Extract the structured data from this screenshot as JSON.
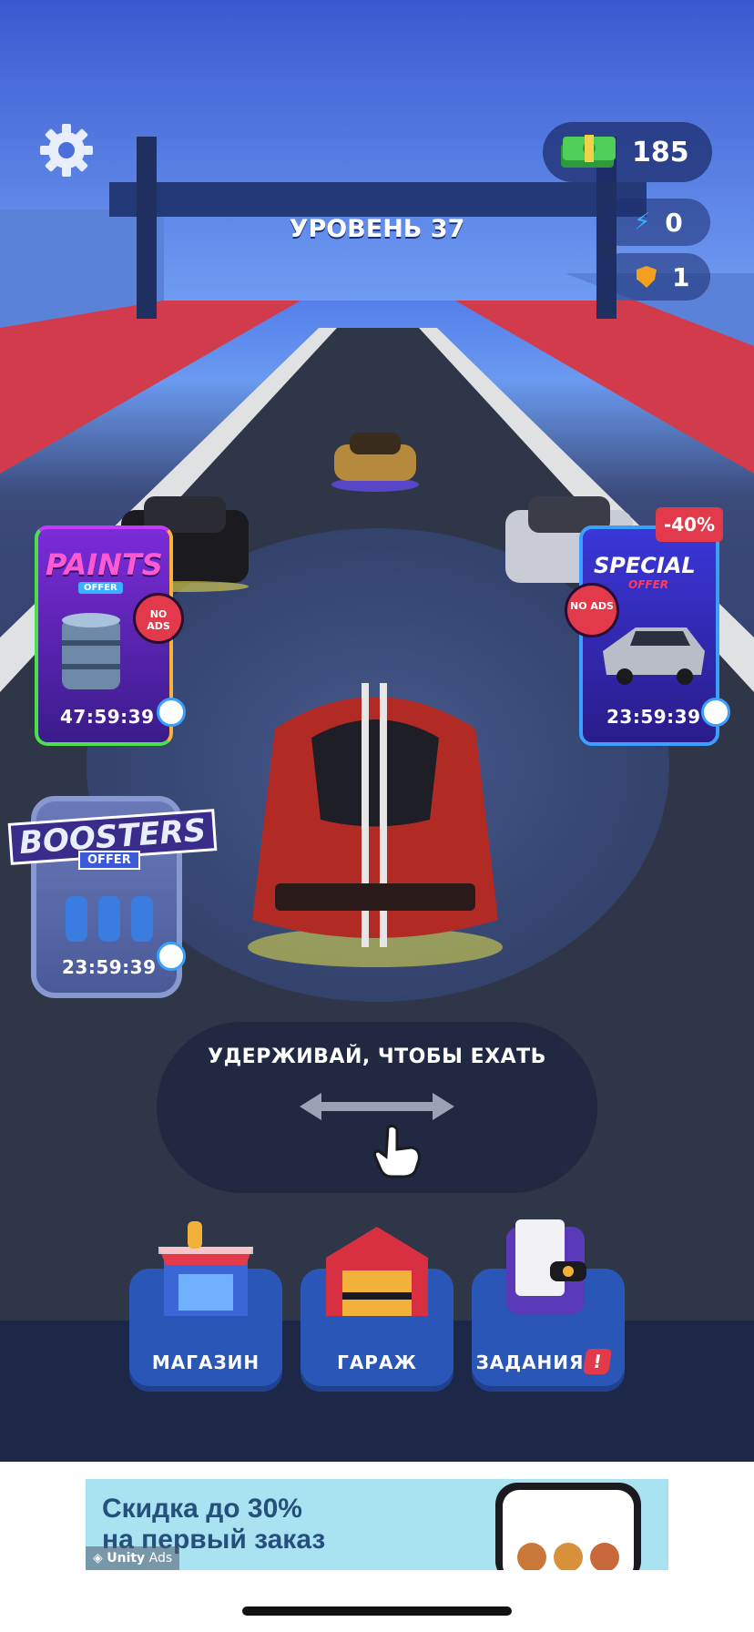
{
  "hud": {
    "money": "185",
    "energy": "0",
    "shields": "1",
    "level": "УРОВЕНЬ 37"
  },
  "offers": {
    "paints": {
      "title": "PAINTS",
      "tag": "OFFER",
      "noads": "NO ADS",
      "timer": "47:59:39"
    },
    "special": {
      "title": "SPECIAL",
      "tag": "OFFER",
      "discount": "-40%",
      "noads": "NO ADS",
      "timer": "23:59:39"
    },
    "boosters": {
      "title": "BOOSTERS",
      "tag": "OFFER",
      "timer": "23:59:39"
    }
  },
  "hint": {
    "text": "УДЕРЖИВАЙ, ЧТОБЫ ЕХАТЬ"
  },
  "menu": {
    "shop": "МАГАЗИН",
    "garage": "ГАРАЖ",
    "tasks": "ЗАДАНИЯ",
    "tasks_badge": "!"
  },
  "ad": {
    "line1": "Скидка до 30%",
    "line2": "на первый заказ",
    "brand": "Unity",
    "brand_suffix": "Ads"
  },
  "colors": {
    "accent_blue": "#2a56b8",
    "discount_red": "#e23a4a",
    "money_green": "#3fbf4a"
  }
}
